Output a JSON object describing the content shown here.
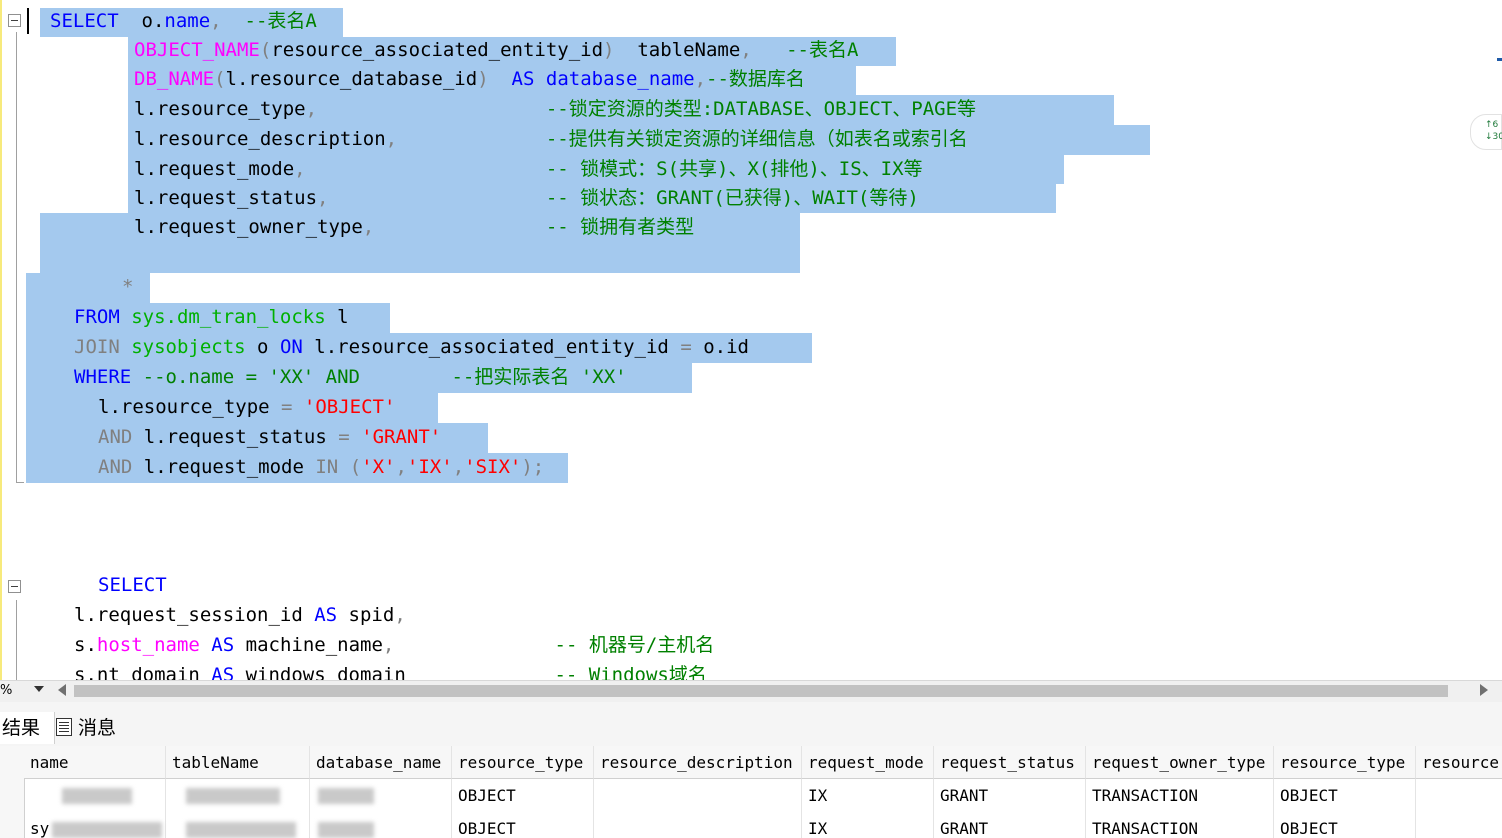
{
  "editor": {
    "lines_query1": [
      {
        "tokens": [
          [
            "kw",
            "SELECT"
          ],
          [
            "",
            "  o."
          ],
          [
            "kw",
            "name"
          ],
          [
            "op",
            ","
          ],
          [
            "",
            "  "
          ],
          [
            "cm",
            "--表名A"
          ]
        ]
      },
      {
        "tokens": [
          [
            "fn",
            "OBJECT_NAME"
          ],
          [
            "op",
            "("
          ],
          [
            "",
            "resource_associated_entity_id"
          ],
          [
            "op",
            ")"
          ],
          [
            "",
            "  tableName"
          ],
          [
            "op",
            ","
          ],
          [
            "",
            "   "
          ],
          [
            "cm",
            "--表名A"
          ]
        ]
      },
      {
        "tokens": [
          [
            "fn",
            "DB_NAME"
          ],
          [
            "op",
            "("
          ],
          [
            "",
            "l.resource_database_id"
          ],
          [
            "op",
            ")"
          ],
          [
            "",
            "  "
          ],
          [
            "kw",
            "AS"
          ],
          [
            "",
            ""
          ],
          [
            "kw",
            " database_name"
          ],
          [
            "op",
            ","
          ],
          [
            "cm",
            "--数据库名"
          ]
        ]
      },
      {
        "tokens": [
          [
            "",
            "l.resource_type"
          ],
          [
            "op",
            ","
          ],
          [
            "",
            "                    "
          ],
          [
            "cm",
            "--锁定资源的类型:DATABASE、OBJECT、PAGE等"
          ]
        ]
      },
      {
        "tokens": [
          [
            "",
            "l.resource_description"
          ],
          [
            "op",
            ","
          ],
          [
            "",
            "             "
          ],
          [
            "cm",
            "--提供有关锁定资源的详细信息（如表名或索引名"
          ]
        ]
      },
      {
        "tokens": [
          [
            "",
            "l.request_mode"
          ],
          [
            "op",
            ","
          ],
          [
            "",
            "                     "
          ],
          [
            "cm",
            "-- 锁模式：S(共享)、X(排他)、IS、IX等"
          ]
        ]
      },
      {
        "tokens": [
          [
            "",
            "l.request_status"
          ],
          [
            "op",
            ","
          ],
          [
            "",
            "                   "
          ],
          [
            "cm",
            "-- 锁状态：GRANT(已获得)、WAIT(等待)"
          ]
        ]
      },
      {
        "tokens": [
          [
            "",
            "l.request_owner_type"
          ],
          [
            "op",
            ","
          ],
          [
            "",
            "               "
          ],
          [
            "cm",
            "-- 锁拥有者类型"
          ]
        ]
      }
    ],
    "star": "*",
    "from_line": {
      "tokens": [
        [
          "kw",
          "FROM"
        ],
        [
          "",
          ""
        ],
        [
          "sys",
          " sys.dm_tran_locks"
        ],
        [
          "",
          " l"
        ]
      ]
    },
    "join_line": {
      "tokens": [
        [
          "op",
          "JOIN"
        ],
        [
          "sys",
          " sysobjects"
        ],
        [
          "",
          " o "
        ],
        [
          "kw",
          "ON"
        ],
        [
          "",
          " l.resource_associated_entity_id "
        ],
        [
          "op",
          "="
        ],
        [
          "",
          " o.id"
        ]
      ]
    },
    "where_line": {
      "tokens": [
        [
          "kw",
          "WHERE"
        ],
        [
          "cm",
          " --o.name = 'XX' AND        --把实际表名 'XX'"
        ]
      ]
    },
    "cond1": {
      "tokens": [
        [
          "",
          "l.resource_type "
        ],
        [
          "op",
          "="
        ],
        [
          "str",
          " 'OBJECT'"
        ]
      ]
    },
    "cond2": {
      "tokens": [
        [
          "op",
          "AND"
        ],
        [
          "",
          " l.request_status "
        ],
        [
          "op",
          "="
        ],
        [
          "str",
          " 'GRANT'"
        ]
      ]
    },
    "cond3": {
      "tokens": [
        [
          "op",
          "AND"
        ],
        [
          "",
          " l.request_mode "
        ],
        [
          "op",
          "IN"
        ],
        [
          "op",
          " ("
        ],
        [
          "str",
          "'X'"
        ],
        [
          "op",
          ","
        ],
        [
          "str",
          "'IX'"
        ],
        [
          "op",
          ","
        ],
        [
          "str",
          "'SIX'"
        ],
        [
          "op",
          ");"
        ]
      ]
    },
    "select2": {
      "tokens": [
        [
          "kw",
          "SELECT"
        ]
      ]
    },
    "spid_line": {
      "tokens": [
        [
          "",
          "l.request_session_id "
        ],
        [
          "kw",
          "AS"
        ],
        [
          "",
          " spid"
        ],
        [
          "op",
          ","
        ]
      ]
    },
    "host_line": {
      "tokens": [
        [
          "",
          "s."
        ],
        [
          "fn",
          "host_name"
        ],
        [
          "",
          " "
        ],
        [
          "kw",
          "AS"
        ],
        [
          "",
          " machine_name"
        ],
        [
          "op",
          ","
        ],
        [
          "",
          "              "
        ],
        [
          "cm",
          "-- 机器号/主机名"
        ]
      ]
    },
    "domain_line": {
      "tokens": [
        [
          "",
          "s.nt_domain "
        ],
        [
          "kw",
          "AS"
        ],
        [
          "",
          " windows_domain"
        ],
        [
          "",
          "             "
        ],
        [
          "cm",
          "-- Windows域名"
        ]
      ]
    }
  },
  "minimap": {
    "up": "↑6",
    "down": "↓30"
  },
  "zoom": {
    "label": "%"
  },
  "tabs": {
    "results": "结果",
    "messages": "消息"
  },
  "grid": {
    "columns": [
      "name",
      "tableName",
      "database_name",
      "resource_type",
      "resource_description",
      "request_mode",
      "request_status",
      "request_owner_type",
      "resource_type",
      "resource"
    ],
    "rows": [
      [
        "",
        "",
        "",
        "OBJECT",
        "",
        "IX",
        "GRANT",
        "TRANSACTION",
        "OBJECT",
        ""
      ],
      [
        "sy",
        "",
        "",
        "OBJECT",
        "",
        "IX",
        "GRANT",
        "TRANSACTION",
        "OBJECT",
        ""
      ]
    ]
  }
}
